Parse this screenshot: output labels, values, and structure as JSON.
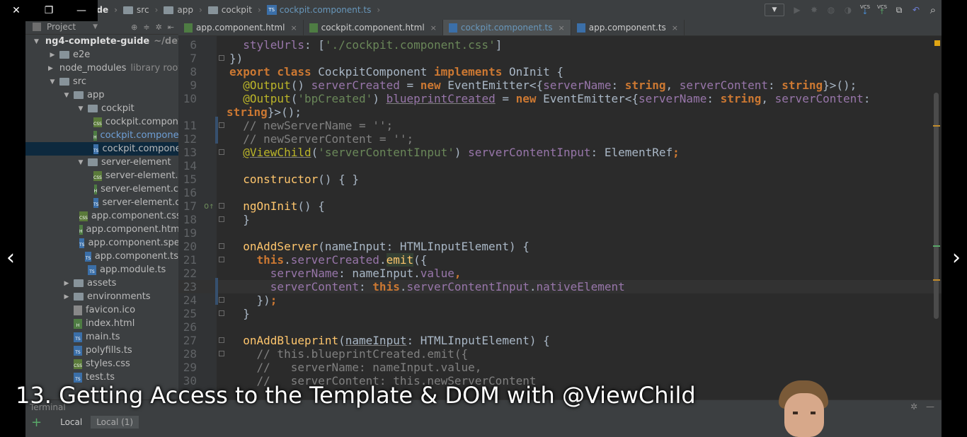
{
  "window_controls": {
    "close": "✕",
    "restore": "❐",
    "minimize": "—"
  },
  "breadcrumb": [
    {
      "label": "e-guide",
      "type": "folder"
    },
    {
      "label": "src",
      "type": "folder"
    },
    {
      "label": "app",
      "type": "folder"
    },
    {
      "label": "cockpit",
      "type": "folder"
    },
    {
      "label": "cockpit.component.ts",
      "type": "file"
    }
  ],
  "toolbar": {
    "vcs1": "VCS",
    "vcs2": "VCS"
  },
  "project_panel": {
    "title": "Project",
    "tree": [
      {
        "label": "ng4-complete-guide",
        "hint": "~/deve",
        "depth": 0,
        "arrow": "▼",
        "kind": "folder",
        "style": "bold"
      },
      {
        "label": "e2e",
        "depth": 1,
        "arrow": "▶",
        "kind": "folder"
      },
      {
        "label": "node_modules",
        "hint": "library root",
        "depth": 1,
        "arrow": "▶",
        "kind": "folder"
      },
      {
        "label": "src",
        "depth": 1,
        "arrow": "▼",
        "kind": "folder"
      },
      {
        "label": "app",
        "depth": 2,
        "arrow": "▼",
        "kind": "folder"
      },
      {
        "label": "cockpit",
        "depth": 3,
        "arrow": "▼",
        "kind": "folder"
      },
      {
        "label": "cockpit.compone",
        "depth": 4,
        "kind": "css"
      },
      {
        "label": "cockpit.compone",
        "depth": 4,
        "kind": "html",
        "style": "blue"
      },
      {
        "label": "cockpit.compone",
        "depth": 4,
        "kind": "ts",
        "style": "selected"
      },
      {
        "label": "server-element",
        "depth": 3,
        "arrow": "▼",
        "kind": "folder"
      },
      {
        "label": "server-element.c",
        "depth": 4,
        "kind": "css"
      },
      {
        "label": "server-element.c",
        "depth": 4,
        "kind": "html"
      },
      {
        "label": "server-element.c",
        "depth": 4,
        "kind": "ts"
      },
      {
        "label": "app.component.css",
        "depth": 3,
        "kind": "css"
      },
      {
        "label": "app.component.htm",
        "depth": 3,
        "kind": "html"
      },
      {
        "label": "app.component.spe",
        "depth": 3,
        "kind": "ts"
      },
      {
        "label": "app.component.ts",
        "depth": 3,
        "kind": "ts"
      },
      {
        "label": "app.module.ts",
        "depth": 3,
        "kind": "ts"
      },
      {
        "label": "assets",
        "depth": 2,
        "arrow": "▶",
        "kind": "folder"
      },
      {
        "label": "environments",
        "depth": 2,
        "arrow": "▶",
        "kind": "folder"
      },
      {
        "label": "favicon.ico",
        "depth": 2,
        "kind": "ico"
      },
      {
        "label": "index.html",
        "depth": 2,
        "kind": "html"
      },
      {
        "label": "main.ts",
        "depth": 2,
        "kind": "ts"
      },
      {
        "label": "polyfills.ts",
        "depth": 2,
        "kind": "ts"
      },
      {
        "label": "styles.css",
        "depth": 2,
        "kind": "css"
      },
      {
        "label": "test.ts",
        "depth": 2,
        "kind": "ts"
      }
    ]
  },
  "tabs": [
    {
      "label": "app.component.html",
      "kind": "html",
      "active": false
    },
    {
      "label": "cockpit.component.html",
      "kind": "html",
      "active": false
    },
    {
      "label": "cockpit.component.ts",
      "kind": "ts",
      "active": true
    },
    {
      "label": "app.component.ts",
      "kind": "ts",
      "active": false
    }
  ],
  "editor": {
    "lines": [
      {
        "n": "6",
        "fold": false,
        "tokens": [
          [
            "t",
            "  "
          ],
          [
            "p",
            "styleUrls"
          ],
          [
            "t",
            ": ["
          ],
          [
            "s",
            "'./cockpit.component.css'"
          ],
          [
            "t",
            "]"
          ]
        ]
      },
      {
        "n": "7",
        "fold": true,
        "tokens": [
          [
            "t",
            "})"
          ]
        ]
      },
      {
        "n": "8",
        "fold": false,
        "tokens": [
          [
            "k",
            "export class "
          ],
          [
            "t",
            "CockpitComponent "
          ],
          [
            "k",
            "implements "
          ],
          [
            "t",
            "OnInit {"
          ]
        ]
      },
      {
        "n": "9",
        "fold": false,
        "tokens": [
          [
            "t",
            "  "
          ],
          [
            "a",
            "@Output"
          ],
          [
            "t",
            "() "
          ],
          [
            "p",
            "serverCreated"
          ],
          [
            "t",
            " = "
          ],
          [
            "k",
            "new "
          ],
          [
            "t",
            "EventEmitter<{"
          ],
          [
            "p",
            "serverName"
          ],
          [
            "t",
            ": "
          ],
          [
            "k",
            "string"
          ],
          [
            "t",
            ", "
          ],
          [
            "p",
            "serverContent"
          ],
          [
            "t",
            ": "
          ],
          [
            "k",
            "string"
          ],
          [
            "t",
            "}>();"
          ]
        ]
      },
      {
        "n": "10",
        "fold": false,
        "tokens": [
          [
            "t",
            "  "
          ],
          [
            "a",
            "@Output"
          ],
          [
            "t",
            "("
          ],
          [
            "s",
            "'bpCreated'"
          ],
          [
            "t",
            ") "
          ],
          [
            "pu",
            "blueprintCreated"
          ],
          [
            "t",
            " = "
          ],
          [
            "k",
            "new "
          ],
          [
            "t",
            "EventEmitter<{"
          ],
          [
            "p",
            "serverName"
          ],
          [
            "t",
            ": "
          ],
          [
            "k",
            "string"
          ],
          [
            "t",
            ", "
          ],
          [
            "p",
            "serverContent"
          ],
          [
            "t",
            ":"
          ]
        ]
      },
      {
        "n": "",
        "fold": false,
        "wrap": true,
        "tokens": [
          [
            "k",
            "string"
          ],
          [
            "t",
            "}>();"
          ]
        ]
      },
      {
        "n": "11",
        "fold": true,
        "tokens": [
          [
            "t",
            "  "
          ],
          [
            "c",
            "// newServerName = '';"
          ]
        ]
      },
      {
        "n": "12",
        "fold": false,
        "tokens": [
          [
            "t",
            "  "
          ],
          [
            "c",
            "// newServerContent = '';"
          ]
        ]
      },
      {
        "n": "13",
        "fold": true,
        "tokens": [
          [
            "t",
            "  "
          ],
          [
            "au",
            "@ViewChild"
          ],
          [
            "t",
            "("
          ],
          [
            "s",
            "'serverContentInput'"
          ],
          [
            "t",
            ") "
          ],
          [
            "p",
            "serverContentInput"
          ],
          [
            "t",
            ": ElementRef"
          ],
          [
            "k",
            ";"
          ]
        ]
      },
      {
        "n": "14",
        "fold": false,
        "tokens": []
      },
      {
        "n": "15",
        "fold": false,
        "tokens": [
          [
            "t",
            "  "
          ],
          [
            "f",
            "constructor"
          ],
          [
            "t",
            "() { }"
          ]
        ]
      },
      {
        "n": "16",
        "fold": false,
        "tokens": []
      },
      {
        "n": "17",
        "fold": true,
        "mark": "o↑",
        "tokens": [
          [
            "t",
            "  "
          ],
          [
            "f",
            "ngOnInit"
          ],
          [
            "t",
            "() {"
          ]
        ]
      },
      {
        "n": "18",
        "fold": true,
        "tokens": [
          [
            "t",
            "  }"
          ]
        ]
      },
      {
        "n": "19",
        "fold": false,
        "tokens": []
      },
      {
        "n": "20",
        "fold": true,
        "tokens": [
          [
            "t",
            "  "
          ],
          [
            "f",
            "onAddServer"
          ],
          [
            "t",
            "(nameInput: HTMLInputElement) {"
          ]
        ]
      },
      {
        "n": "21",
        "fold": true,
        "tokens": [
          [
            "t",
            "    "
          ],
          [
            "k",
            "this"
          ],
          [
            "t",
            "."
          ],
          [
            "p",
            "serverCreated"
          ],
          [
            "t",
            "."
          ],
          [
            "fh",
            "emit"
          ],
          [
            "t",
            "({"
          ]
        ]
      },
      {
        "n": "22",
        "fold": false,
        "tokens": [
          [
            "t",
            "      "
          ],
          [
            "p",
            "serverName"
          ],
          [
            "t",
            ": nameInput."
          ],
          [
            "p",
            "value"
          ],
          [
            "k",
            ","
          ]
        ]
      },
      {
        "n": "23",
        "fold": false,
        "current": true,
        "tokens": [
          [
            "t",
            "      "
          ],
          [
            "p",
            "serverContent"
          ],
          [
            "t",
            ": "
          ],
          [
            "k",
            "this"
          ],
          [
            "t",
            "."
          ],
          [
            "p",
            "serverContentInput"
          ],
          [
            "t",
            "."
          ],
          [
            "p",
            "nativeElement"
          ]
        ]
      },
      {
        "n": "24",
        "fold": true,
        "tokens": [
          [
            "t",
            "    })"
          ],
          [
            "k",
            ";"
          ]
        ]
      },
      {
        "n": "25",
        "fold": true,
        "tokens": [
          [
            "t",
            "  }"
          ]
        ]
      },
      {
        "n": "26",
        "fold": false,
        "tokens": []
      },
      {
        "n": "27",
        "fold": true,
        "tokens": [
          [
            "t",
            "  "
          ],
          [
            "f",
            "onAddBlueprint"
          ],
          [
            "t",
            "("
          ],
          [
            "tu",
            "nameInput"
          ],
          [
            "t",
            ": HTMLInputElement) {"
          ]
        ]
      },
      {
        "n": "28",
        "fold": true,
        "tokens": [
          [
            "t",
            "    "
          ],
          [
            "c",
            "// this.blueprintCreated.emit({"
          ]
        ]
      },
      {
        "n": "29",
        "fold": false,
        "tokens": [
          [
            "t",
            "    "
          ],
          [
            "c",
            "//   serverName: nameInput.value,"
          ]
        ]
      },
      {
        "n": "30",
        "fold": false,
        "tokens": [
          [
            "t",
            "    "
          ],
          [
            "c",
            "//   serverContent: this.newServerContent"
          ]
        ]
      }
    ]
  },
  "bottom_panel": {
    "title": "Terminal",
    "add": "+",
    "tabs": [
      {
        "label": "Local",
        "active": false
      },
      {
        "label": "Local (1)",
        "active": true
      }
    ]
  },
  "video": {
    "caption": "13. Getting Access to the Template & DOM with @ViewChild",
    "prev": "‹",
    "next": "›"
  }
}
